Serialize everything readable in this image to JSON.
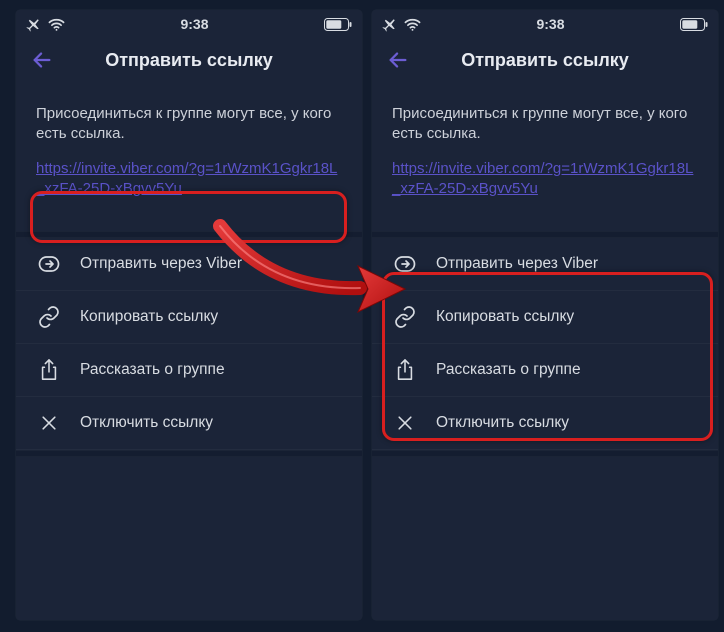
{
  "status": {
    "time": "9:38"
  },
  "header": {
    "title": "Отправить ссылку"
  },
  "info": {
    "desc": "Присоединиться к группе могут все, у кого есть ссылка.",
    "link": "https://invite.viber.com/?g=1rWzmK1Ggkr18L_xzFA-25D-xBgvv5Yu"
  },
  "actions": {
    "send": "Отправить через Viber",
    "copy": "Копировать ссылку",
    "tell": "Рассказать о группе",
    "disable": "Отключить ссылку"
  },
  "colors": {
    "accent": "#6c5dd3",
    "link": "#5a52c8",
    "callout": "#d81f1f",
    "bg_screen": "#1b2438",
    "bg_outer": "#121c2e"
  }
}
